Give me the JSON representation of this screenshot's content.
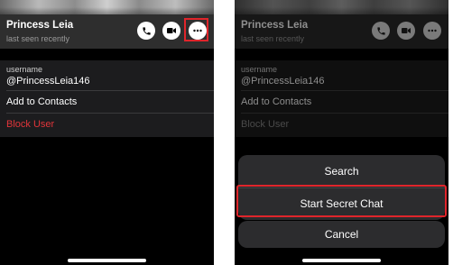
{
  "profile": {
    "name": "Princess Leia",
    "status": "last seen recently"
  },
  "actions": {
    "call_icon": "phone-icon",
    "video_icon": "video-camera-icon",
    "more_icon": "more-dots-icon"
  },
  "info": {
    "username_label": "username",
    "username_value": "@PrincessLeia146",
    "add_contacts": "Add to Contacts",
    "block_user": "Block User"
  },
  "action_sheet": {
    "search": "Search",
    "start_secret_chat": "Start Secret Chat",
    "cancel": "Cancel"
  },
  "colors": {
    "highlight": "#e0252b",
    "destructive": "#e0353a",
    "background": "#000000",
    "sheet": "#2c2c2e"
  }
}
